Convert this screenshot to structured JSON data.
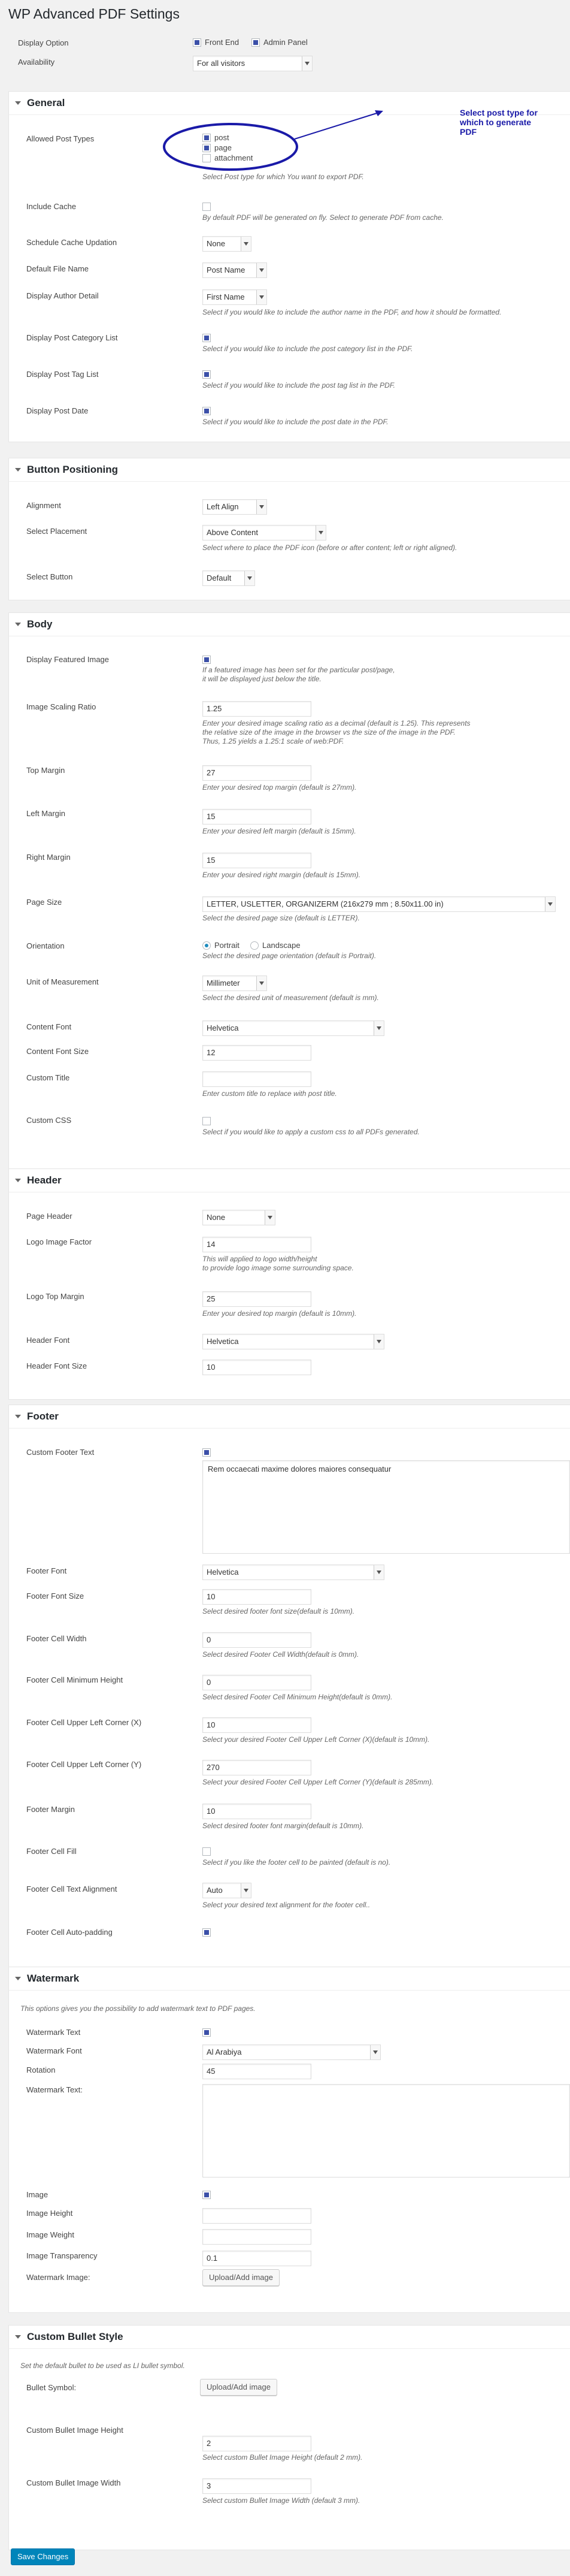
{
  "page": {
    "title": "WP Advanced PDF Settings"
  },
  "top": {
    "display_option_label": "Display Option",
    "front_end_label": "Front End",
    "admin_panel_label": "Admin Panel",
    "availability_label": "Availability",
    "availability_value": "For all visitors"
  },
  "annotation": {
    "text": "Select post type for which to generate PDF",
    "color": "#1a1aa8"
  },
  "general": {
    "title": "General",
    "allowed_post_types_label": "Allowed Post Types",
    "post_types": [
      "post",
      "page",
      "attachment"
    ],
    "post_types_desc": "Select Post type for which You want to export PDF.",
    "include_cache_label": "Include Cache",
    "include_cache_desc": "By default PDF will be generated on fly. Select to generate PDF from cache.",
    "schedule_cache_label": "Schedule Cache Updation",
    "schedule_cache_value": "None",
    "default_file_name_label": "Default File Name",
    "default_file_name_value": "Post Name",
    "display_author_label": "Display Author Detail",
    "display_author_value": "First Name",
    "display_author_desc": "Select if you would like to include the author name in the PDF, and how it should be formatted.",
    "category_list_label": "Display Post Category List",
    "category_list_desc": "Select if you would like to include the post category list in the PDF.",
    "tag_list_label": "Display Post Tag List",
    "tag_list_desc": "Select if you would like to include the post tag list in the PDF.",
    "post_date_label": "Display Post Date",
    "post_date_desc": "Select if you would like to include the post date in the PDF."
  },
  "button_positioning": {
    "title": "Button Positioning",
    "alignment_label": "Alignment",
    "alignment_value": "Left Align",
    "placement_label": "Select Placement",
    "placement_value": "Above Content",
    "placement_desc": "Select where to place the PDF icon (before or after content; left or right aligned).",
    "button_label": "Select Button",
    "button_value": "Default"
  },
  "body": {
    "title": "Body",
    "featured_image_label": "Display Featured Image",
    "featured_image_desc_1": "If a featured image has been set for the particular post/page,",
    "featured_image_desc_2": "it will be displayed just below the title.",
    "scaling_label": "Image Scaling Ratio",
    "scaling_value": "1.25",
    "scaling_desc_1": "Enter your desired image scaling ratio as a decimal (default is 1.25). This represents",
    "scaling_desc_2": "the relative size of the image in the browser vs the size of the image in the PDF.",
    "scaling_desc_3": "Thus, 1.25 yields a 1.25:1 scale of web:PDF.",
    "top_margin_label": "Top Margin",
    "top_margin_value": "27",
    "top_margin_desc": "Enter your desired top margin (default is 27mm).",
    "left_margin_label": "Left Margin",
    "left_margin_value": "15",
    "left_margin_desc": "Enter your desired left margin (default is 15mm).",
    "right_margin_label": "Right Margin",
    "right_margin_value": "15",
    "right_margin_desc": "Enter your desired right margin (default is 15mm).",
    "page_size_label": "Page Size",
    "page_size_value": "LETTER, USLETTER, ORGANIZERM (216x279 mm ; 8.50x11.00 in)",
    "page_size_desc": "Select the desired page size (default is LETTER).",
    "orientation_label": "Orientation",
    "orientation_portrait": "Portrait",
    "orientation_landscape": "Landscape",
    "orientation_desc": "Select the desired page orientation (default is Portrait).",
    "unit_label": "Unit of Measurement",
    "unit_value": "Millimeter",
    "unit_desc": "Select the desired unit of measurement (default is mm).",
    "content_font_label": "Content Font",
    "content_font_value": "Helvetica",
    "content_font_size_label": "Content Font Size",
    "content_font_size_value": "12",
    "custom_title_label": "Custom Title",
    "custom_title_value": "",
    "custom_title_desc": "Enter custom title to replace with post title.",
    "custom_css_label": "Custom CSS",
    "custom_css_desc": "Select if you would like to apply a custom css to all PDFs generated."
  },
  "header": {
    "title": "Header",
    "page_header_label": "Page Header",
    "page_header_value": "None",
    "logo_factor_label": "Logo Image Factor",
    "logo_factor_value": "14",
    "logo_factor_desc_1": "This will applied to logo width/height",
    "logo_factor_desc_2": "to provide logo image some surrounding space.",
    "logo_top_margin_label": "Logo Top Margin",
    "logo_top_margin_value": "25",
    "logo_top_margin_desc": "Enter your desired top margin (default is 10mm).",
    "header_font_label": "Header Font",
    "header_font_value": "Helvetica",
    "header_font_size_label": "Header Font Size",
    "header_font_size_value": "10"
  },
  "footer": {
    "title": "Footer",
    "custom_footer_label": "Custom Footer Text",
    "custom_footer_value": "Rem occaecati maxime dolores maiores consequatur",
    "footer_font_label": "Footer Font",
    "footer_font_value": "Helvetica",
    "footer_font_size_label": "Footer Font Size",
    "footer_font_size_value": "10",
    "footer_font_size_desc": "Select desired footer font size(default is 10mm).",
    "cell_width_label": "Footer Cell Width",
    "cell_width_value": "0",
    "cell_width_desc": "Select desired Footer Cell Width(default is 0mm).",
    "cell_min_height_label": "Footer Cell Minimum Height",
    "cell_min_height_value": "0",
    "cell_min_height_desc": "Select desired Footer Cell Minimum Height(default is 0mm).",
    "cell_x_label": "Footer Cell Upper Left Corner (X)",
    "cell_x_value": "10",
    "cell_x_desc": "Select your desired Footer Cell Upper Left Corner (X)(default is 10mm).",
    "cell_y_label": "Footer Cell Upper Left Corner (Y)",
    "cell_y_value": "270",
    "cell_y_desc": "Select your desired Footer Cell Upper Left Corner (Y)(default is 285mm).",
    "margin_label": "Footer Margin",
    "margin_value": "10",
    "margin_desc": "Select desired footer font margin(default is 10mm).",
    "cell_fill_label": "Footer Cell Fill",
    "cell_fill_desc": "Select if you like the footer cell to be painted (default is no).",
    "text_align_label": "Footer Cell Text Alignment",
    "text_align_value": "Auto",
    "text_align_desc": "Select your desired text alignment for the footer cell..",
    "auto_padding_label": "Footer Cell Auto-padding"
  },
  "watermark": {
    "title": "Watermark",
    "intro": "This options gives you the possibility to add watermark text to PDF pages.",
    "text_label": "Watermark Text",
    "font_label": "Watermark Font",
    "font_value": "Al Arabiya",
    "rotation_label": "Rotation",
    "rotation_value": "45",
    "watermark_text_label": "Watermark Text:",
    "watermark_text_value": "",
    "image_label": "Image",
    "image_height_label": "Image Height",
    "image_height_value": "",
    "image_weight_label": "Image Weight",
    "image_weight_value": "",
    "image_transparency_label": "Image Transparency",
    "image_transparency_value": "0.1",
    "watermark_image_label": "Watermark Image:",
    "upload_button": "Upload/Add image"
  },
  "bullet": {
    "title": "Custom Bullet Style",
    "intro": "Set the default bullet to be used as LI bullet symbol.",
    "symbol_label": "Bullet Symbol:",
    "upload_button": "Upload/Add image",
    "height_label": "Custom Bullet Image Height",
    "height_value": "2",
    "height_desc": "Select custom Bullet Image Height (default 2 mm).",
    "width_label": "Custom Bullet Image Width",
    "width_value": "3",
    "width_desc": "Select custom Bullet Image Width (default 3 mm)."
  },
  "save_button": "Save Changes"
}
